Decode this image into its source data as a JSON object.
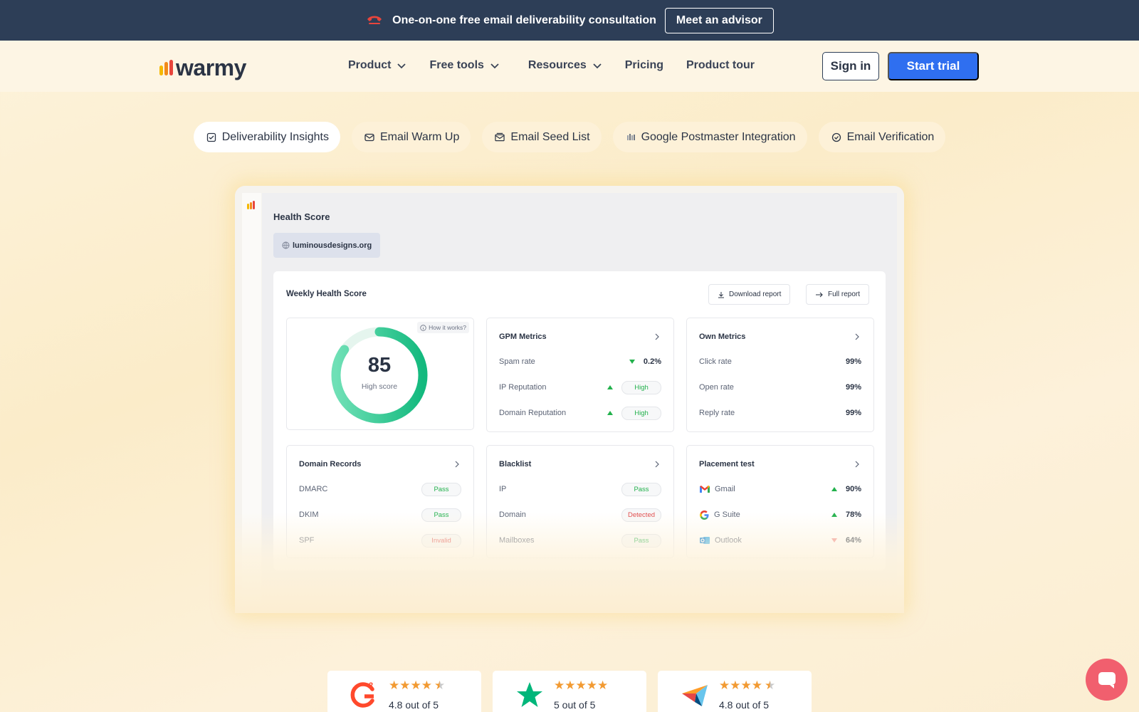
{
  "banner": {
    "message": "One-on-one free email deliverability consultation",
    "cta": "Meet an advisor"
  },
  "nav": {
    "logo": "warmy",
    "items": [
      {
        "label": "Product",
        "dropdown": true
      },
      {
        "label": "Free tools",
        "dropdown": true
      },
      {
        "label": "Resources",
        "dropdown": true
      },
      {
        "label": "Pricing",
        "dropdown": false
      },
      {
        "label": "Product tour",
        "dropdown": false
      }
    ],
    "sign_in": "Sign in",
    "start_trial": "Start trial"
  },
  "tabs": [
    {
      "label": "Deliverability Insights",
      "icon": "checklist-icon",
      "active": true
    },
    {
      "label": "Email Warm Up",
      "icon": "envelope-icon",
      "active": false
    },
    {
      "label": "Email Seed List",
      "icon": "mail-list-icon",
      "active": false
    },
    {
      "label": "Google Postmaster Integration",
      "icon": "postmaster-icon",
      "active": false
    },
    {
      "label": "Email Verification",
      "icon": "check-circle-icon",
      "active": false
    }
  ],
  "dashboard": {
    "title": "Health Score",
    "domain": "luminousdesigns.org",
    "panel_title": "Weekly Health Score",
    "download_report": "Download report",
    "full_report": "Full report",
    "score": {
      "value": "85",
      "label": "High score",
      "how_it_works": "How it works?",
      "fill": 0.85
    },
    "gpm": {
      "title": "GPM Metrics",
      "rows": [
        {
          "label": "Spam rate",
          "value": "0.2%",
          "trend": "down"
        },
        {
          "label": "IP Reputation",
          "value": "High",
          "trend": "up"
        },
        {
          "label": "Domain Reputation",
          "value": "High",
          "trend": "up"
        }
      ]
    },
    "own": {
      "title": "Own Metrics",
      "rows": [
        {
          "label": "Click rate",
          "value": "99%"
        },
        {
          "label": "Open rate",
          "value": "99%"
        },
        {
          "label": "Reply rate",
          "value": "99%"
        }
      ]
    },
    "domain_records": {
      "title": "Domain Records",
      "rows": [
        {
          "label": "DMARC",
          "value": "Pass",
          "status": "pass"
        },
        {
          "label": "DKIM",
          "value": "Pass",
          "status": "pass"
        },
        {
          "label": "SPF",
          "value": "Invalid",
          "status": "fail"
        }
      ]
    },
    "blacklist": {
      "title": "Blacklist",
      "rows": [
        {
          "label": "IP",
          "value": "Pass",
          "status": "pass"
        },
        {
          "label": "Domain",
          "value": "Detected",
          "status": "fail"
        },
        {
          "label": "Mailboxes",
          "value": "Pass",
          "status": "pass"
        }
      ]
    },
    "placement": {
      "title": "Placement test",
      "rows": [
        {
          "label": "Gmail",
          "value": "90%",
          "trend": "up",
          "icon": "gmail-icon"
        },
        {
          "label": "G Suite",
          "value": "78%",
          "trend": "up",
          "icon": "google-icon"
        },
        {
          "label": "Outlook",
          "value": "64%",
          "trend": "down",
          "icon": "outlook-icon"
        }
      ]
    }
  },
  "reviews": [
    {
      "source_icon": "g2-logo-icon",
      "rating_text": "4.8 out of 5",
      "stars": 4.5
    },
    {
      "source_icon": "trustpilot-star-icon",
      "rating_text": "5 out of 5",
      "stars": 5
    },
    {
      "source_icon": "capterra-logo-icon",
      "rating_text": "4.8 out of 5",
      "stars": 4.5
    }
  ],
  "colors": {
    "banner_bg": "#2d3e57",
    "primary": "#2f6ff0",
    "success": "#22b14c",
    "danger": "#e04a4a",
    "star": "#f29a32",
    "chat": "#f15f6e"
  }
}
